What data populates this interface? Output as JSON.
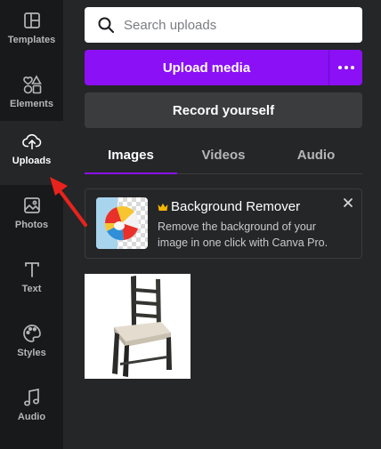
{
  "rail": {
    "items": [
      {
        "label": "Templates",
        "icon": "template-icon"
      },
      {
        "label": "Elements",
        "icon": "elements-icon"
      },
      {
        "label": "Uploads",
        "icon": "cloud-upload-icon",
        "active": true
      },
      {
        "label": "Photos",
        "icon": "photo-icon"
      },
      {
        "label": "Text",
        "icon": "text-icon"
      },
      {
        "label": "Styles",
        "icon": "palette-icon"
      },
      {
        "label": "Audio",
        "icon": "music-note-icon"
      }
    ]
  },
  "search": {
    "placeholder": "Search uploads"
  },
  "upload": {
    "label": "Upload media"
  },
  "record": {
    "label": "Record yourself"
  },
  "tabs": [
    {
      "label": "Images",
      "active": true
    },
    {
      "label": "Videos"
    },
    {
      "label": "Audio"
    }
  ],
  "promo": {
    "title": "Background Remover",
    "description": "Remove the background of your image in one click with Canva Pro."
  },
  "colors": {
    "accent": "#8b10f5",
    "rail_bg": "#18191b",
    "panel_bg": "#252627",
    "crown": "#f5b400",
    "annotation": "#e8231d"
  }
}
